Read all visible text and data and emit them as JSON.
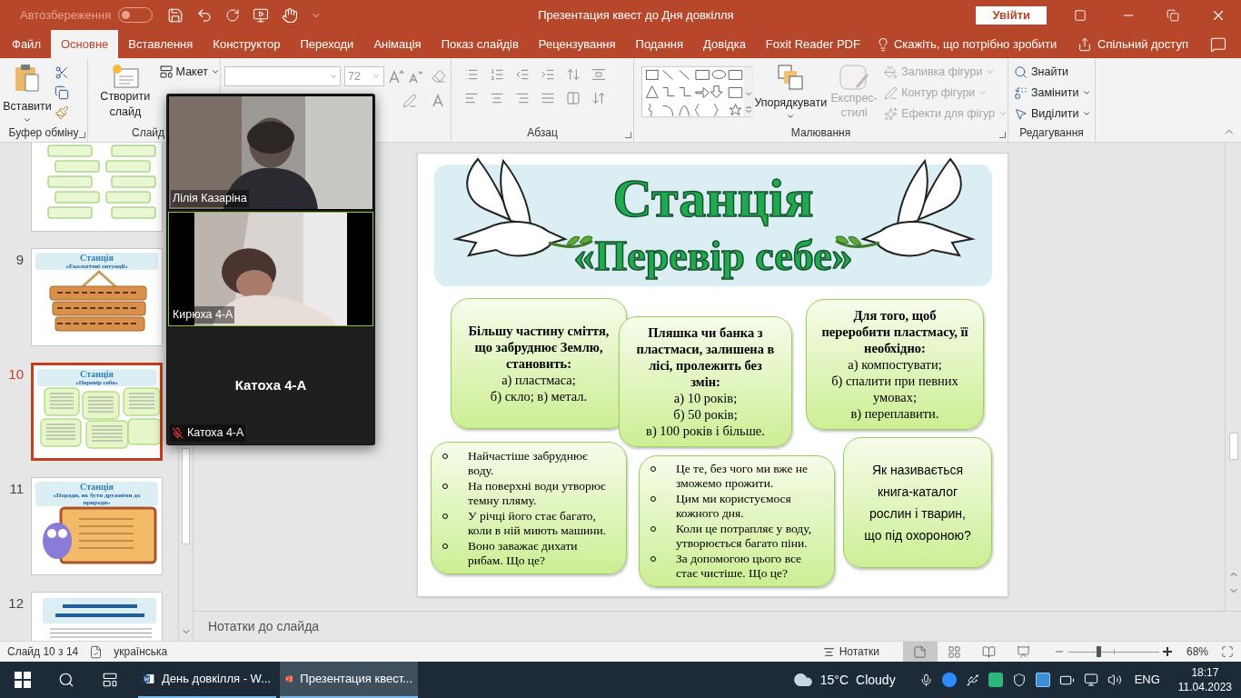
{
  "title_bar": {
    "autosave": {
      "label": "Автозбереження",
      "on": false
    },
    "title": "Презентация квест до Дня довкілля",
    "sign_in": "Увійти"
  },
  "tabs": [
    {
      "label": "Файл",
      "selected": false
    },
    {
      "label": "Основне",
      "selected": true
    },
    {
      "label": "Вставлення",
      "selected": false
    },
    {
      "label": "Конструктор",
      "selected": false
    },
    {
      "label": "Переходи",
      "selected": false
    },
    {
      "label": "Анімація",
      "selected": false
    },
    {
      "label": "Показ слайдів",
      "selected": false
    },
    {
      "label": "Рецензування",
      "selected": false
    },
    {
      "label": "Подання",
      "selected": false
    },
    {
      "label": "Довідка",
      "selected": false
    },
    {
      "label": "Foxit Reader PDF",
      "selected": false
    }
  ],
  "tell_me": "Скажіть, що потрібно зробити",
  "share": "Спільний доступ",
  "ribbon": {
    "clipboard": {
      "paste": "Вставити",
      "label": "Буфер обміну"
    },
    "slides": {
      "new_slide": "Створити слайд",
      "layout": "Макет",
      "label": "Слайд"
    },
    "font": {
      "size": "72"
    },
    "paragraph": {
      "label": "Абзац"
    },
    "drawing": {
      "arrange": "Упорядкувати",
      "quick_styles": {
        "label": "Експрес-стилі",
        "disabled": true
      },
      "commands": [
        {
          "label": "Заливка фігури",
          "disabled": true
        },
        {
          "label": "Контур фігури",
          "disabled": true
        },
        {
          "label": "Ефекти для фігур",
          "disabled": true
        }
      ],
      "label": "Малювання"
    },
    "editing": {
      "commands": [
        {
          "kind": "find",
          "label": "Знайти"
        },
        {
          "kind": "replace",
          "label": "Замінити"
        },
        {
          "kind": "select",
          "label": "Виділити"
        }
      ],
      "label": "Редагування"
    }
  },
  "thumbnails": [
    {
      "kind": "boxes",
      "selected": false
    },
    {
      "number": "9",
      "kind": "boards",
      "title": "Станція",
      "subtitle": "«Екологічні ситуації»",
      "selected": false
    },
    {
      "number": "10",
      "kind": "quiz",
      "title": "Станція",
      "subtitle": "«Перевір себе»",
      "selected": true
    },
    {
      "number": "11",
      "kind": "owl",
      "title": "Станція",
      "subtitle": "«Поради, як бути дружніми до природи»",
      "selected": false
    },
    {
      "number": "12",
      "kind": "memo",
      "selected": false
    }
  ],
  "slide": {
    "title": "Станція",
    "subtitle": "«Перевір себе»",
    "cards": [
      {
        "kind": "question",
        "question": "Більшу частину сміття, що забруднює Землю, становить:",
        "options": [
          "а) пластмаса;",
          "б) скло; в) метал."
        ]
      },
      {
        "kind": "question",
        "question": "Пляшка чи банка з пластмаси, залишена в лісі, пролежить без змін:",
        "options": [
          "а) 10 років;",
          "б) 50 років;",
          "в) 100 років і більше."
        ]
      },
      {
        "kind": "question",
        "question": "Для того, щоб переробити пластмасу, її необхідно:",
        "options": [
          "а) компостувати;",
          "б) спалити при певних умовах;",
          "в) переплавити."
        ]
      },
      {
        "kind": "bullets",
        "items": [
          "Найчастіше забруднює воду.",
          "На поверхні води утворює темну пляму.",
          "У річці його стає багато, коли в ній миють машини.",
          "Воно заважає дихати рибам. Що це?"
        ]
      },
      {
        "kind": "bullets",
        "items": [
          "Це те, без чого ми вже не зможемо прожити.",
          "Цим ми користуємося кожного дня.",
          "Коли це потрапляє у воду, утворюється багато піни.",
          "За допомогою цього все стає чистіше. Що це?"
        ]
      },
      {
        "kind": "plain",
        "text": "Як називається книга-каталог рослин і тварин, що під охороною?"
      }
    ]
  },
  "notes_placeholder": "Нотатки до слайда",
  "video_call": {
    "participants": [
      {
        "kind": "video",
        "name": "Лілія Казаріна",
        "speaking": false
      },
      {
        "kind": "video",
        "name": "Кирюха 4-А",
        "speaking": true
      },
      {
        "kind": "no_video",
        "display_name": "Катоха 4-А",
        "name": "Катоха 4-А",
        "muted": true
      }
    ]
  },
  "status_bar": {
    "slide_position": "Слайд 10 з 14",
    "language": "українська",
    "notes": "Нотатки",
    "views": [
      {
        "kind": "normal",
        "selected": true
      },
      {
        "kind": "sorter",
        "selected": false
      },
      {
        "kind": "reading",
        "selected": false
      },
      {
        "kind": "show",
        "selected": false
      }
    ],
    "zoom": {
      "level": 0.33,
      "reading": "68%"
    }
  },
  "taskbar": {
    "apps": [
      {
        "kind": "word",
        "label": "День довкілля - W...",
        "selected": false
      },
      {
        "kind": "powerpoint",
        "label": "Презентация квест...",
        "selected": true
      }
    ],
    "weather": {
      "temperature": "15°C",
      "condition": "Cloudy"
    },
    "language": "ENG",
    "time": "18:17",
    "date": "11.04.2023"
  }
}
